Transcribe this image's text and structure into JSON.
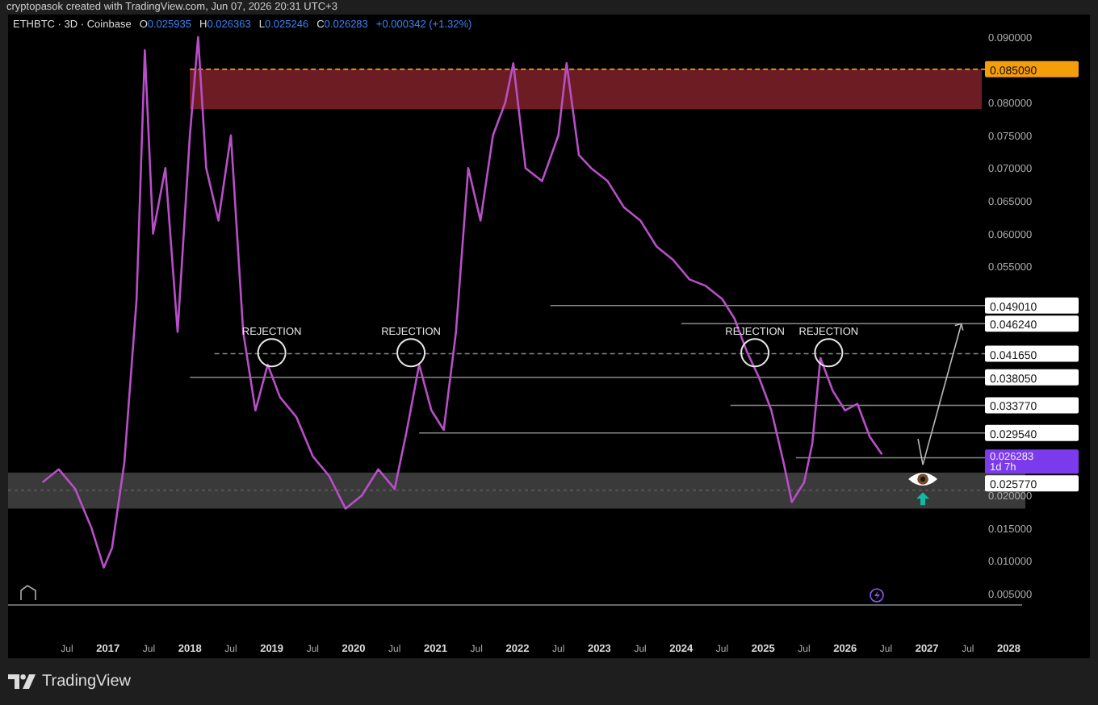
{
  "attribution": "cryptopasok created with TradingView.com, Jun 07, 2026 20:31 UTC+3",
  "legend": {
    "symbol": "ETHBTC · 3D · Coinbase",
    "ohlc": [
      {
        "key": "O",
        "value": "0.025935"
      },
      {
        "key": "H",
        "value": "0.026363"
      },
      {
        "key": "L",
        "value": "0.025246"
      },
      {
        "key": "C",
        "value": "0.026283"
      }
    ],
    "change": "+0.000342 (+1.32%)"
  },
  "chart": {
    "chart_data": {
      "type": "line",
      "x": [
        2016.2,
        2016.4,
        2016.6,
        2016.8,
        2016.95,
        2017.05,
        2017.2,
        2017.35,
        2017.45,
        2017.55,
        2017.7,
        2017.85,
        2018.0,
        2018.1,
        2018.2,
        2018.35,
        2018.5,
        2018.65,
        2018.8,
        2018.95,
        2019.1,
        2019.3,
        2019.5,
        2019.7,
        2019.9,
        2020.1,
        2020.3,
        2020.5,
        2020.65,
        2020.8,
        2020.95,
        2021.1,
        2021.25,
        2021.4,
        2021.55,
        2021.7,
        2021.85,
        2021.95,
        2022.1,
        2022.3,
        2022.5,
        2022.6,
        2022.75,
        2022.9,
        2023.1,
        2023.3,
        2023.5,
        2023.7,
        2023.9,
        2024.1,
        2024.3,
        2024.5,
        2024.65,
        2024.8,
        2024.95,
        2025.1,
        2025.25,
        2025.35,
        2025.5,
        2025.6,
        2025.7,
        2025.85,
        2026.0,
        2026.15,
        2026.3,
        2026.45
      ],
      "series": [
        {
          "color": "#b84fc8",
          "values": [
            0.022,
            0.024,
            0.021,
            0.015,
            0.009,
            0.012,
            0.025,
            0.05,
            0.088,
            0.06,
            0.07,
            0.045,
            0.075,
            0.09,
            0.07,
            0.062,
            0.075,
            0.045,
            0.033,
            0.04,
            0.035,
            0.032,
            0.026,
            0.023,
            0.018,
            0.02,
            0.024,
            0.021,
            0.03,
            0.04,
            0.033,
            0.03,
            0.045,
            0.07,
            0.062,
            0.075,
            0.08,
            0.086,
            0.07,
            0.068,
            0.075,
            0.086,
            0.072,
            0.07,
            0.068,
            0.064,
            0.062,
            0.058,
            0.056,
            0.053,
            0.052,
            0.05,
            0.047,
            0.042,
            0.038,
            0.033,
            0.025,
            0.019,
            0.022,
            0.028,
            0.041,
            0.036,
            0.033,
            0.034,
            0.029,
            0.0263
          ]
        }
      ],
      "xticks": [
        {
          "value": 2016.5,
          "label": "Jul"
        },
        {
          "value": 2017,
          "label": "2017"
        },
        {
          "value": 2017.5,
          "label": "Jul"
        },
        {
          "value": 2018,
          "label": "2018"
        },
        {
          "value": 2018.5,
          "label": "Jul"
        },
        {
          "value": 2019,
          "label": "2019"
        },
        {
          "value": 2019.5,
          "label": "Jul"
        },
        {
          "value": 2020,
          "label": "2020"
        },
        {
          "value": 2020.5,
          "label": "Jul"
        },
        {
          "value": 2021,
          "label": "2021"
        },
        {
          "value": 2021.5,
          "label": "Jul"
        },
        {
          "value": 2022,
          "label": "2022"
        },
        {
          "value": 2022.5,
          "label": "Jul"
        },
        {
          "value": 2023,
          "label": "2023"
        },
        {
          "value": 2023.5,
          "label": "Jul"
        },
        {
          "value": 2024,
          "label": "2024"
        },
        {
          "value": 2024.5,
          "label": "Jul"
        },
        {
          "value": 2025,
          "label": "2025"
        },
        {
          "value": 2025.5,
          "label": "Jul"
        },
        {
          "value": 2026,
          "label": "2026"
        },
        {
          "value": 2026.5,
          "label": "Jul"
        },
        {
          "value": 2027,
          "label": "2027"
        },
        {
          "value": 2027.5,
          "label": "Jul"
        },
        {
          "value": 2028,
          "label": "2028"
        }
      ],
      "yticks": [
        {
          "value": 0.09,
          "label": "0.090000"
        },
        {
          "value": 0.08,
          "label": "0.080000"
        },
        {
          "value": 0.075,
          "label": "0.075000"
        },
        {
          "value": 0.07,
          "label": "0.070000"
        },
        {
          "value": 0.065,
          "label": "0.065000"
        },
        {
          "value": 0.06,
          "label": "0.060000"
        },
        {
          "value": 0.055,
          "label": "0.055000"
        },
        {
          "value": 0.02,
          "label": "0.020000"
        },
        {
          "value": 0.015,
          "label": "0.015000"
        },
        {
          "value": 0.01,
          "label": "0.010000"
        },
        {
          "value": 0.005,
          "label": "0.005000"
        }
      ],
      "xlim": [
        2015.78,
        2028.99
      ],
      "ylim": [
        0.00328,
        0.09345
      ],
      "ref_lines": [
        {
          "label": "0.085090",
          "color": "#f59e0b"
        },
        {
          "label": "0.049010",
          "color": "#ffffff"
        },
        {
          "label": "0.046240",
          "color": "#ffffff"
        },
        {
          "label": "0.041650",
          "color": "#ffffff"
        },
        {
          "label": "0.038050",
          "color": "#ffffff"
        },
        {
          "label": "0.033770",
          "color": "#ffffff"
        },
        {
          "label": "0.029540",
          "color": "#ffffff"
        },
        {
          "label": "0.025770",
          "color": "#ffffff"
        }
      ],
      "annotations": [
        {
          "text": "REJECTION"
        },
        {
          "text": "REJECTION"
        },
        {
          "text": "REJECTION"
        },
        {
          "text": "REJECTION"
        }
      ]
    },
    "current_price": {
      "label": "0.026283",
      "countdown": "1d 7h"
    }
  },
  "footer": {
    "brand": "TradingView"
  }
}
